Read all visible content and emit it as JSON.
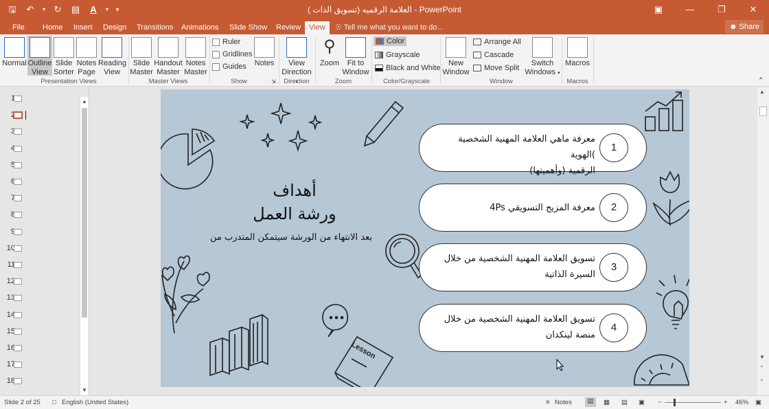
{
  "window": {
    "title": "العلامة الرقميه (تسويق الذات ) - PowerPoint"
  },
  "tabs": {
    "items": [
      "File",
      "Home",
      "Insert",
      "Design",
      "Transitions",
      "Animations",
      "Slide Show",
      "Review",
      "View"
    ],
    "active": "View",
    "tell_me": "Tell me what you want to do...",
    "share": "Share"
  },
  "ribbon": {
    "presentation_views": {
      "normal": "Normal",
      "outline_view": [
        "Outline",
        "View"
      ],
      "slide_sorter": [
        "Slide",
        "Sorter"
      ],
      "notes_page": [
        "Notes",
        "Page"
      ],
      "reading_view": [
        "Reading",
        "View"
      ],
      "group": "Presentation Views"
    },
    "master_views": {
      "slide_master": [
        "Slide",
        "Master"
      ],
      "handout_master": [
        "Handout",
        "Master"
      ],
      "notes_master": [
        "Notes",
        "Master"
      ],
      "group": "Master Views"
    },
    "show": {
      "ruler": "Ruler",
      "gridlines": "Gridlines",
      "guides": "Guides",
      "notes": "Notes",
      "group": "Show"
    },
    "direction": {
      "view_direction": [
        "View",
        "Direction"
      ],
      "group": "Direction"
    },
    "zoom": {
      "zoom": "Zoom",
      "fit_to_window": [
        "Fit to",
        "Window"
      ],
      "group": "Zoom"
    },
    "color": {
      "color": "Color",
      "grayscale": "Grayscale",
      "black_white": "Black and White",
      "group": "Color/Grayscale"
    },
    "window": {
      "new_window": [
        "New",
        "Window"
      ],
      "arrange_all": "Arrange All",
      "cascade": "Cascade",
      "move_split": "Move Split",
      "switch_windows": [
        "Switch",
        "Windows"
      ],
      "group": "Window"
    },
    "macros": {
      "macros": "Macros",
      "group": "Macros"
    }
  },
  "thumbnails": {
    "numbers": [
      "1",
      "2",
      "3",
      "4",
      "5",
      "6",
      "7",
      "8",
      "9",
      "10",
      "11",
      "12",
      "13",
      "14",
      "15",
      "16",
      "17",
      "18"
    ],
    "selected": 2
  },
  "slide": {
    "heading_line1": "أهداف",
    "heading_line2": "ورشة العمل",
    "subline": "بعد الانتهاء من الورشة سيتمكن المتدرب من",
    "goals": [
      {
        "num": "1",
        "line1": "معرفة ماهي العلامة المهنية الشخصية )الهوية",
        "line2": "الرقمية (وأهميتها)"
      },
      {
        "num": "2",
        "line1": "معرفة المزيج التسويقي 4Ps",
        "line2": ""
      },
      {
        "num": "3",
        "line1": "تسويق العلامة المهنية الشخصية من خلال",
        "line2": "السيرة الذاتية"
      },
      {
        "num": "4",
        "line1": "تسويق العلامة المهنية الشخصية من خلال",
        "line2": "منصة لينكدان"
      }
    ],
    "book_label": "Lesson"
  },
  "status": {
    "slide_info": "Slide 2 of 25",
    "language": "English (United States)",
    "notes": "Notes",
    "zoom": "46%"
  },
  "colors": {
    "accent": "#c55a33",
    "slide_bg": "#b6c7d5"
  }
}
